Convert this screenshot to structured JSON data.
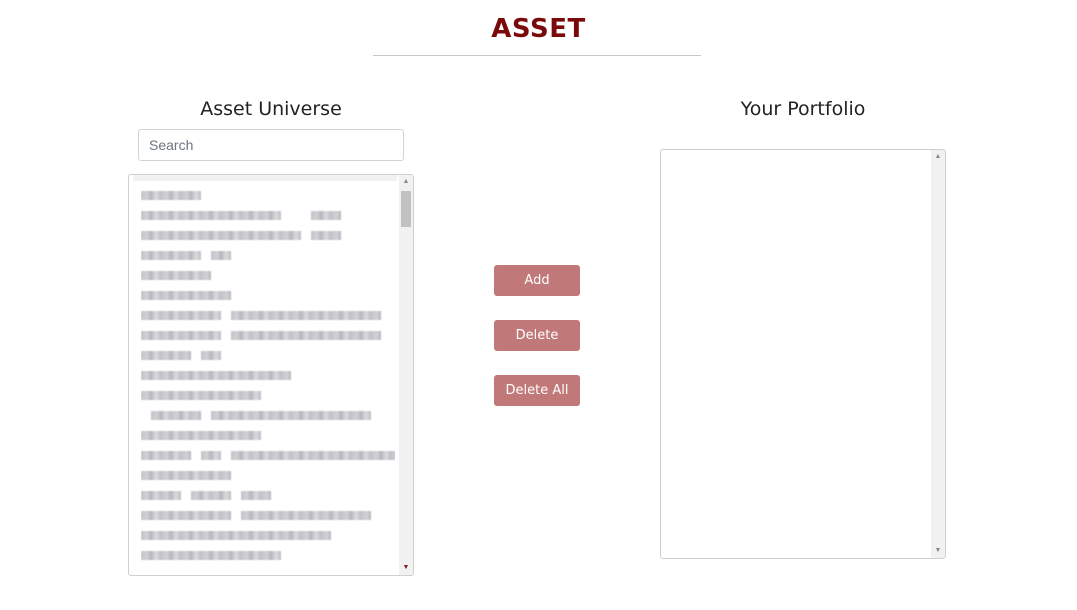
{
  "app": {
    "title": "ASSET"
  },
  "universe": {
    "heading": "Asset Universe",
    "search": {
      "placeholder": "Search",
      "value": ""
    },
    "items": [
      {
        "label": ""
      },
      {
        "label": ""
      },
      {
        "label": ""
      },
      {
        "label": ""
      },
      {
        "label": ""
      },
      {
        "label": ""
      },
      {
        "label": ""
      },
      {
        "label": ""
      },
      {
        "label": ""
      },
      {
        "label": ""
      },
      {
        "label": ""
      },
      {
        "label": ""
      },
      {
        "label": ""
      },
      {
        "label": ""
      },
      {
        "label": ""
      },
      {
        "label": ""
      },
      {
        "label": ""
      },
      {
        "label": ""
      },
      {
        "label": ""
      }
    ]
  },
  "portfolio": {
    "heading": "Your Portfolio",
    "items": []
  },
  "actions": {
    "add_label": "Add",
    "delete_label": "Delete",
    "delete_all_label": "Delete All"
  },
  "colors": {
    "title": "#7a0a0a",
    "button": "#c07878",
    "button_text": "#ffffff"
  },
  "icons": {
    "scroll_up": "scroll-up-arrow-icon",
    "scroll_down": "scroll-down-arrow-icon"
  }
}
